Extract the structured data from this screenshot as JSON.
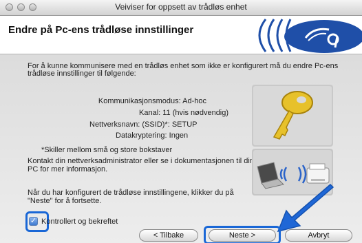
{
  "window": {
    "title": "Veiviser for oppsett av trådløs enhet"
  },
  "header": {
    "heading": "Endre på Pc-ens trådløse innstillinger"
  },
  "intro": {
    "line1": "For å kunne kommunisere med en trådløs enhet som ikke er konfigurert må du endre Pc-ens",
    "line2": "trådløse innstillinger til følgende:"
  },
  "settings": {
    "mode": "Kommunikasjonsmodus: Ad-hoc",
    "channel": "Kanal: 11  (hvis nødvendig)",
    "ssid": "Nettverksnavn: (SSID)*: SETUP",
    "encryption": "Datakryptering: Ingen"
  },
  "note": "*Skiller mellom små og store bokstaver",
  "contact": {
    "line1": "Kontakt din nettverksadministrator eller se i dokumentasjonen til din",
    "line2": "PC for mer informasjon."
  },
  "instruction": {
    "line1": "Når du har konfigurert de trådløse innstillingene, klikker du på",
    "line2": "\"Neste\" for å fortsette."
  },
  "checkbox": {
    "label": "Kontrollert og bekreftet",
    "checked": true
  },
  "buttons": {
    "back": "< Tilbake",
    "next": "Neste >",
    "cancel": "Avbryt"
  },
  "colors": {
    "highlight": "#1a67d6",
    "logo_blue": "#1f4fa8"
  },
  "icons": [
    "wireless-logo-icon",
    "key-icon",
    "laptop-printer-icon",
    "arrow-icon"
  ]
}
